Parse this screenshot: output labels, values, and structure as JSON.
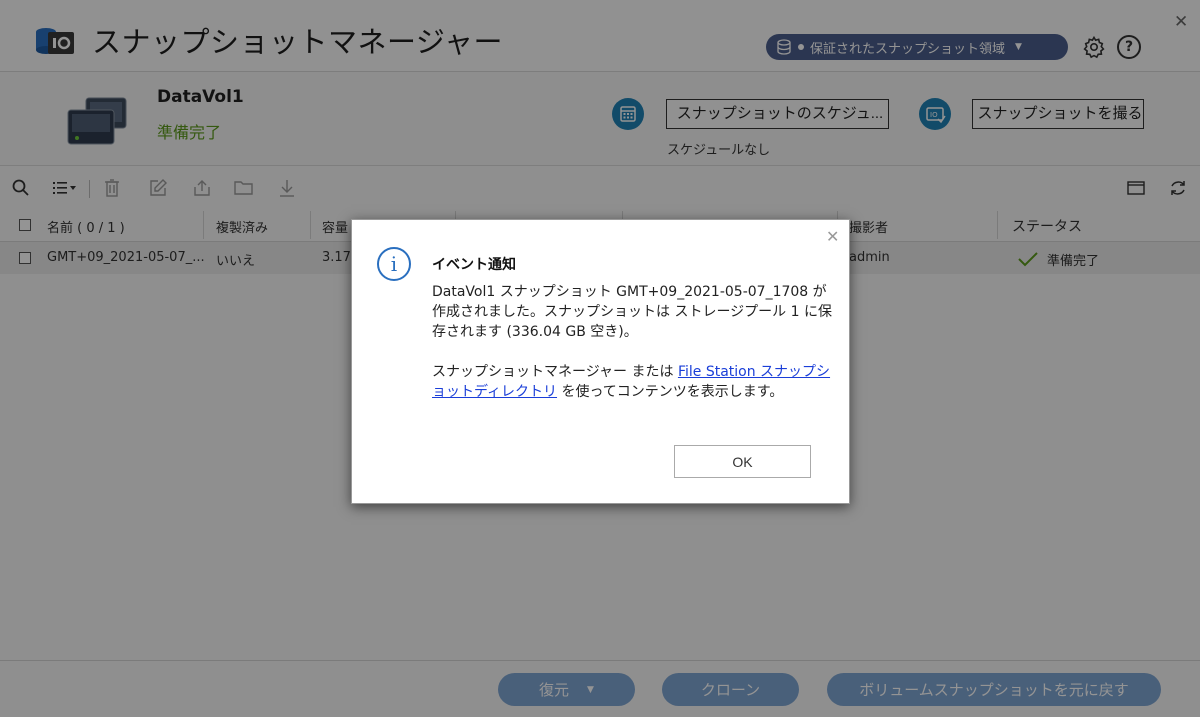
{
  "window": {
    "title": "スナップショットマネージャー",
    "close_glyph": "✕"
  },
  "header": {
    "pool_selector": "保証されたスナップショット領域",
    "help_glyph": "?"
  },
  "volume": {
    "name": "DataVol1",
    "status": "準備完了",
    "schedule_button": "スナップショットのスケジュ...",
    "schedule_status": "スケジュールなし",
    "take_snapshot_button": "スナップショットを撮る"
  },
  "table": {
    "headers": {
      "name": "名前 ( 0 / 1 )",
      "replicated": "複製済み",
      "capacity": "容量",
      "taken_by": "撮影者",
      "status": "ステータス"
    },
    "rows": [
      {
        "name": "GMT+09_2021-05-07_...",
        "replicated": "いいえ",
        "capacity": "3.17",
        "taken_by": "admin",
        "status": "準備完了"
      }
    ]
  },
  "bottom": {
    "restore": "復元",
    "clone": "クローン",
    "revert": "ボリュームスナップショットを元に戻す"
  },
  "dialog": {
    "title": "イベント通知",
    "message_1": "DataVol1 スナップショット GMT+09_2021-05-07_1708 が作成されました。スナップショットは ストレージプール 1 に保存されます (336.04 GB 空き)。",
    "message_2_prefix": "スナップショットマネージャー または",
    "message_2_link": "File Station スナップショットディレクトリ",
    "message_2_suffix": "を使ってコンテンツを表示します。",
    "ok": "OK",
    "close_glyph": "✕"
  },
  "colors": {
    "accent_blue": "#1f82b5",
    "status_green": "#5c9a1c",
    "link_blue": "#1a3ed8",
    "pill_blue": "#7fa5d2"
  }
}
